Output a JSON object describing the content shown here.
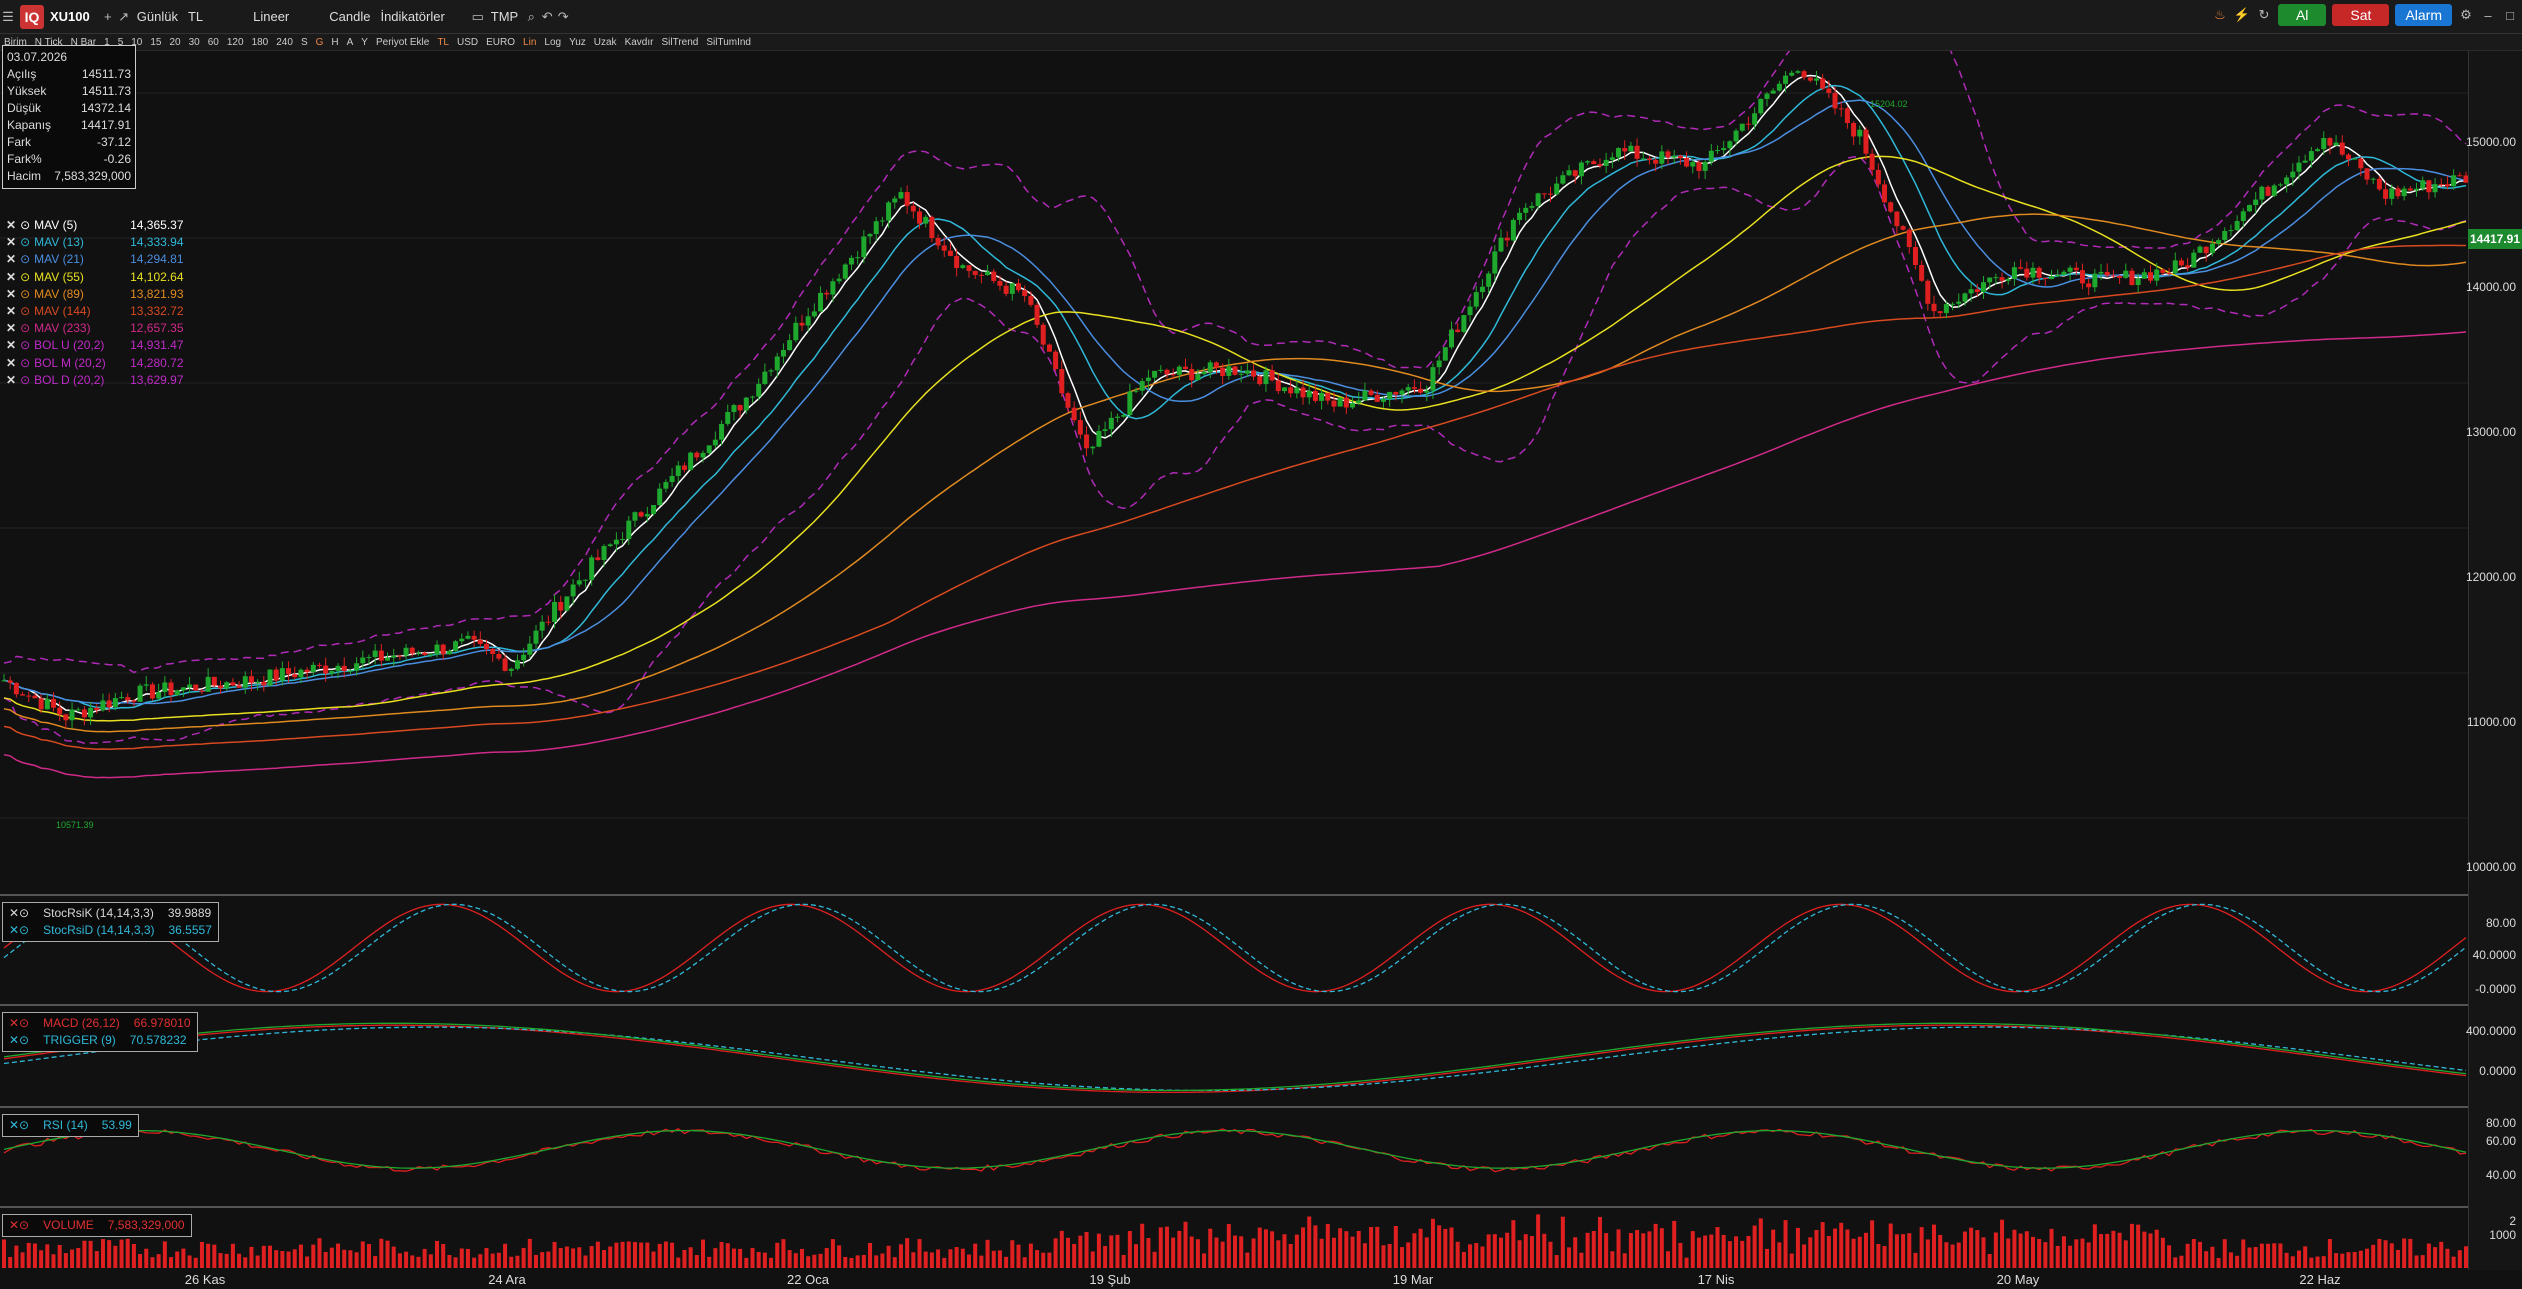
{
  "toolbar": {
    "symbol": "XU100",
    "period": "Günlük",
    "currency": "TL",
    "scale": "Lineer",
    "chart_type": "Candle",
    "indicators": "İndikatörler",
    "template": "TMP",
    "buy": "Al",
    "sell": "Sat",
    "alarm": "Alarm"
  },
  "toolbar2": {
    "items": [
      "Birim",
      "N Tick",
      "N Bar",
      "1",
      "5",
      "10",
      "15",
      "20",
      "30",
      "60",
      "120",
      "180",
      "240",
      "S",
      "G",
      "H",
      "A",
      "Y",
      "Periyot Ekle",
      "TL",
      "USD",
      "EURO",
      "Lin",
      "Log",
      "Yuz",
      "Uzak",
      "Kavdır",
      "SilTrend",
      "SilTumInd"
    ],
    "selected": [
      "G",
      "TL",
      "Lin"
    ]
  },
  "info": {
    "date": "03.07.2026",
    "rows": [
      {
        "label": "Açılış",
        "value": "14511.73"
      },
      {
        "label": "Yüksek",
        "value": "14511.73"
      },
      {
        "label": "Düşük",
        "value": "14372.14"
      },
      {
        "label": "Kapanış",
        "value": "14417.91"
      },
      {
        "label": "Fark",
        "value": "-37.12"
      },
      {
        "label": "Fark%",
        "value": "-0.26"
      },
      {
        "label": "Hacim",
        "value": "7,583,329,000"
      }
    ]
  },
  "legend": [
    {
      "name": "MAV (5)",
      "value": "14,365.37",
      "color": "#ffffff"
    },
    {
      "name": "MAV (13)",
      "value": "14,333.94",
      "color": "#2fb8d8"
    },
    {
      "name": "MAV (21)",
      "value": "14,294.81",
      "color": "#4a8ee0"
    },
    {
      "name": "MAV (55)",
      "value": "14,102.64",
      "color": "#e8e020"
    },
    {
      "name": "MAV (89)",
      "value": "13,821.93",
      "color": "#e08a20"
    },
    {
      "name": "MAV (144)",
      "value": "13,332.72",
      "color": "#d84a20"
    },
    {
      "name": "MAV (233)",
      "value": "12,657.35",
      "color": "#d02a8a"
    },
    {
      "name": "BOL U (20,2)",
      "value": "14,931.47",
      "color": "#c02ac8"
    },
    {
      "name": "BOL M (20,2)",
      "value": "14,280.72",
      "color": "#c02ac8"
    },
    {
      "name": "BOL D (20,2)",
      "value": "13,629.97",
      "color": "#c02ac8"
    }
  ],
  "price_axis": {
    "labels": [
      "15000.00",
      "14000.00",
      "13000.00",
      "12000.00",
      "11000.00",
      "10000.00"
    ],
    "current": "14417.91",
    "high_marker": "15204.02",
    "low_marker": "10571.39"
  },
  "panels": {
    "stoch": {
      "rows": [
        {
          "name": "StocRsiK (14,14,3,3)",
          "value": "39.9889",
          "color": "#d8d8d8"
        },
        {
          "name": "StocRsiD (14,14,3,3)",
          "value": "36.5557",
          "color": "#2fb8d8"
        }
      ],
      "axis": [
        "80.00",
        "40.0000",
        "-0.0000"
      ]
    },
    "macd": {
      "rows": [
        {
          "name": "MACD (26,12)",
          "value": "66.978010",
          "color": "#e03030"
        },
        {
          "name": "TRIGGER (9)",
          "value": "70.578232",
          "color": "#2fb8d8"
        }
      ],
      "axis": [
        "400.0000",
        "0.0000"
      ]
    },
    "rsi": {
      "rows": [
        {
          "name": "RSI (14)",
          "value": "53.99",
          "color": "#2fb8d8"
        }
      ],
      "axis": [
        "80.00",
        "60.00",
        "40.00"
      ]
    },
    "volume": {
      "rows": [
        {
          "name": "VOLUME",
          "value": "7,583,329,000",
          "color": "#e03030"
        }
      ],
      "axis": [
        "2",
        "1000"
      ]
    }
  },
  "x_axis": [
    "26 Kas",
    "24 Ara",
    "22 Oca",
    "19 Şub",
    "19 Mar",
    "17 Nis",
    "20 May",
    "22 Haz"
  ],
  "colors": {
    "up": "#1fa82e",
    "down": "#e02020",
    "bg": "#111111",
    "grid": "#2a2a2a"
  }
}
